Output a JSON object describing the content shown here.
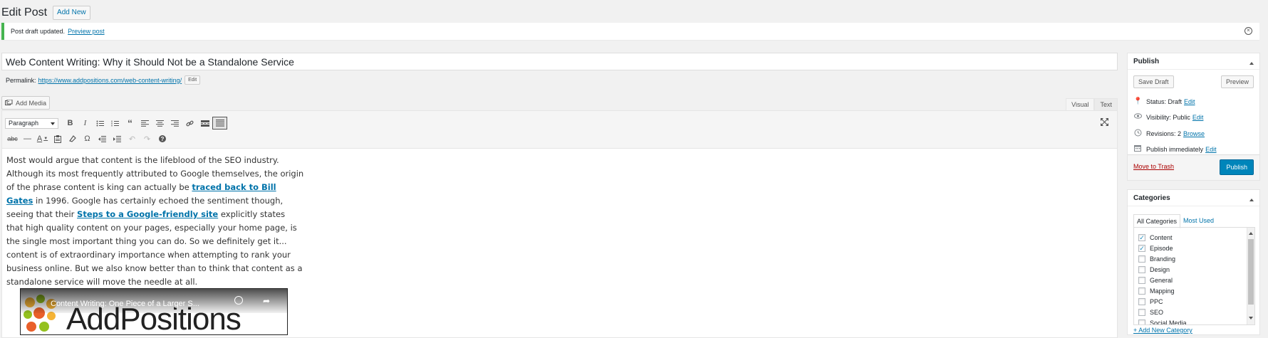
{
  "header": {
    "title": "Edit Post",
    "add_new": "Add New"
  },
  "notice": {
    "text": "Post draft updated.",
    "link": "Preview post"
  },
  "post": {
    "title": "Web Content Writing: Why it Should Not be a Standalone Service",
    "permalink_label": "Permalink:",
    "permalink_url": "https://www.addpositions.com/web-content-writing/",
    "permalink_edit": "Edit"
  },
  "editor": {
    "add_media": "Add Media",
    "tab_visual": "Visual",
    "tab_text": "Text",
    "format_value": "Paragraph",
    "content": {
      "p1": "Most would argue that content is the lifeblood of the SEO industry. Although its most frequently attributed to Google themselves, the origin of the phrase content is king can actually be ",
      "link1": "traced back to Bill Gates",
      "p2": " in 1996. Google has certainly echoed the sentiment though, seeing that their ",
      "link2": "Steps to a Google-friendly site",
      "p3": " explicitly states that high quality content on your pages, especially your home page, is the single most important thing you can do. So we definitely get it... content is of extraordinary importance when attempting to rank your business online. But we also know better than to think that content as a standalone service will move the needle at all."
    },
    "video": {
      "title": "Content Writing: One Piece of a Larger S...",
      "logo": "AddPositions"
    }
  },
  "publish": {
    "heading": "Publish",
    "save_draft": "Save Draft",
    "preview": "Preview",
    "status_label": "Status:",
    "status_value": "Draft",
    "visibility_label": "Visibility:",
    "visibility_value": "Public",
    "revisions_label": "Revisions:",
    "revisions_value": "2",
    "browse": "Browse",
    "publish_label": "Publish",
    "publish_value": "immediately",
    "edit": "Edit",
    "trash": "Move to Trash",
    "publish_button": "Publish"
  },
  "categories": {
    "heading": "Categories",
    "tab_all": "All Categories",
    "tab_most_used": "Most Used",
    "items": [
      {
        "label": "Content",
        "checked": true
      },
      {
        "label": "Episode",
        "checked": true
      },
      {
        "label": "Branding",
        "checked": false
      },
      {
        "label": "Design",
        "checked": false
      },
      {
        "label": "General",
        "checked": false
      },
      {
        "label": "Mapping",
        "checked": false
      },
      {
        "label": "PPC",
        "checked": false
      },
      {
        "label": "SEO",
        "checked": false
      },
      {
        "label": "Social Media",
        "checked": false
      }
    ],
    "add_new": "+ Add New Category"
  }
}
